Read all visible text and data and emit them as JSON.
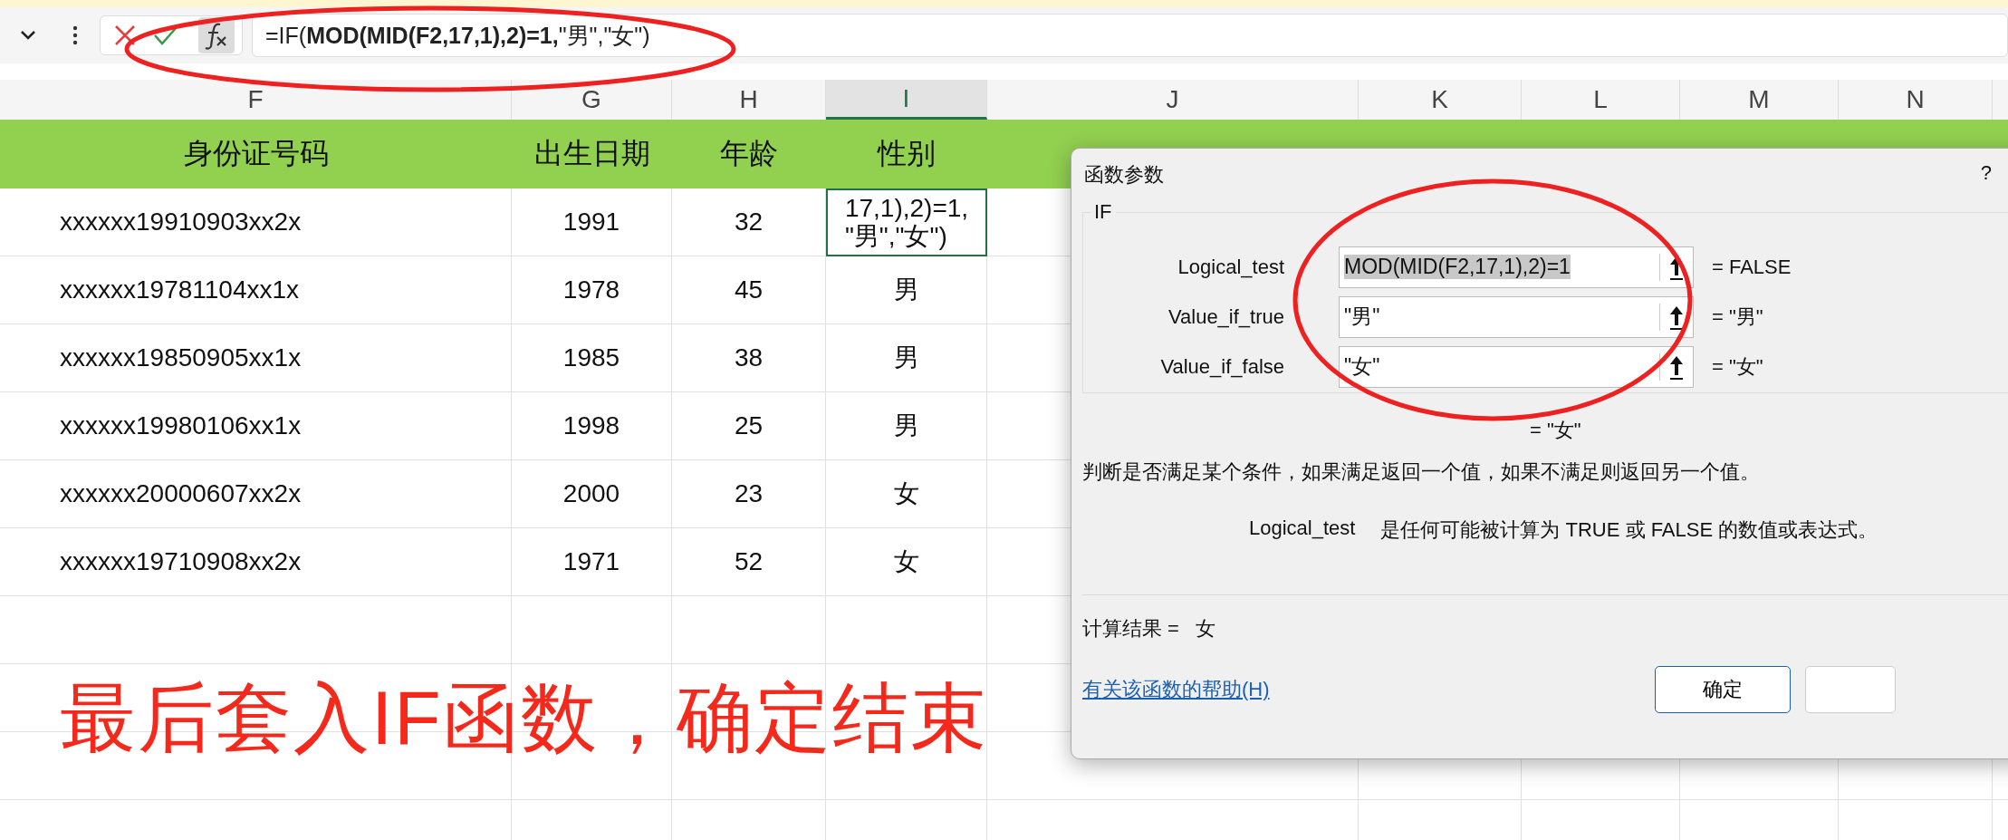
{
  "formula_bar": {
    "formula": "=IF(**MOD(MID(F2,17,1),2)=1,**\"男\",\"女\")"
  },
  "columns": [
    {
      "label": "F",
      "selected": false
    },
    {
      "label": "G",
      "selected": false
    },
    {
      "label": "H",
      "selected": false
    },
    {
      "label": "I",
      "selected": true
    },
    {
      "label": "J",
      "selected": false
    },
    {
      "label": "K",
      "selected": false
    },
    {
      "label": "L",
      "selected": false
    },
    {
      "label": "M",
      "selected": false
    },
    {
      "label": "N",
      "selected": false
    }
  ],
  "header_row": [
    "身份证号码",
    "出生日期",
    "年龄",
    "性别"
  ],
  "rows": [
    {
      "cells": [
        "xxxxxx19910903xx2x",
        "1991",
        "32",
        "17,1),2)=1,\n\"男\",\"女\")"
      ],
      "editing": true
    },
    {
      "cells": [
        "xxxxxx19781104xx1x",
        "1978",
        "45",
        "男"
      ],
      "editing": false
    },
    {
      "cells": [
        "xxxxxx19850905xx1x",
        "1985",
        "38",
        "男"
      ],
      "editing": false
    },
    {
      "cells": [
        "xxxxxx19980106xx1x",
        "1998",
        "25",
        "男"
      ],
      "editing": false
    },
    {
      "cells": [
        "xxxxxx20000607xx2x",
        "2000",
        "23",
        "女"
      ],
      "editing": false
    },
    {
      "cells": [
        "xxxxxx19710908xx2x",
        "1971",
        "52",
        "女"
      ],
      "editing": false
    }
  ],
  "annotation": "最后套入IF函数，确定结束",
  "dialog": {
    "title": "函数参数",
    "help_mark": "?",
    "function": "IF",
    "arguments": [
      {
        "label": "Logical_test",
        "value": "MOD(MID(F2,17,1),2)=1",
        "result": "=  FALSE",
        "selected": true
      },
      {
        "label": "Value_if_true",
        "value": "\"男\"",
        "result": "=  \"男\"",
        "selected": false
      },
      {
        "label": "Value_if_false",
        "value": "\"女\"",
        "result": "=  \"女\"",
        "selected": false
      }
    ],
    "formula_result": "=  \"女\"",
    "description": "判断是否满足某个条件，如果满足返回一个值，如果不满足则返回另一个值。",
    "argument_help_label": "Logical_test",
    "argument_help": "是任何可能被计算为 TRUE 或 FALSE 的数值或表达式。",
    "result_label": "计算结果 =",
    "result_value": "女",
    "help_link": "有关该函数的帮助(H)",
    "ok_button": "确定"
  }
}
